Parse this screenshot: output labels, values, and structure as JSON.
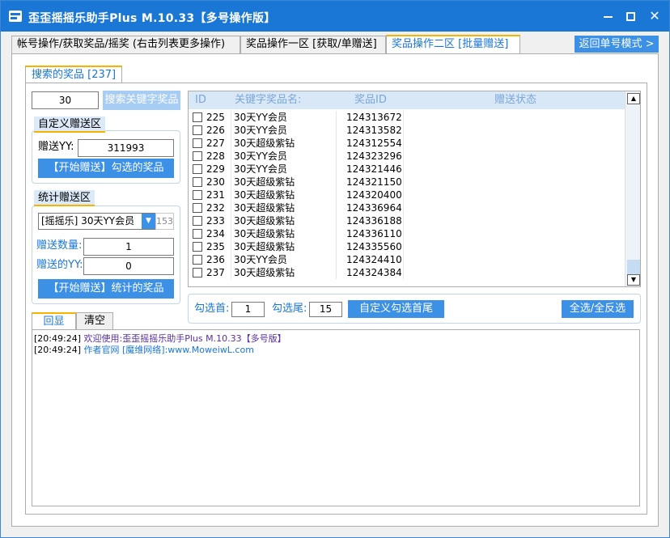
{
  "window": {
    "title": "歪歪摇摇乐助手Plus M.10.33【多号操作版】"
  },
  "tabs": [
    {
      "label": "帐号操作/获取奖品/摇奖 (右击列表更多操作)"
    },
    {
      "label": "奖品操作一区 [获取/单赠送]"
    },
    {
      "label": "奖品操作二区 [批量赠送]"
    }
  ],
  "return_button": "返回单号模式 >",
  "subtab": "搜索的奖品 [237]",
  "search": {
    "keyword": "30",
    "button": "搜索关键字奖品"
  },
  "custom_gift": {
    "title": "自定义赠送区",
    "yy_label": "赠送YY:",
    "yy_value": "311993",
    "button": "【开始赠送】勾选的奖品"
  },
  "stat_gift": {
    "title": "统计赠送区",
    "select_value": "[摇摇乐] 30天YY会员",
    "select_count": "153",
    "qty_label": "赠送数量:",
    "qty_value": "1",
    "yy_label": "赠送的YY:",
    "yy_value": "0",
    "button": "【开始赠送】统计的奖品"
  },
  "list": {
    "headers": [
      "ID",
      "关键字奖品名:",
      "奖品ID",
      "赠送状态"
    ],
    "rows": [
      {
        "id": "225",
        "name": "30天YY会员",
        "prize_id": "124313672",
        "status": ""
      },
      {
        "id": "226",
        "name": "30天YY会员",
        "prize_id": "124313582",
        "status": ""
      },
      {
        "id": "227",
        "name": "30天超级紫钻",
        "prize_id": "124312554",
        "status": ""
      },
      {
        "id": "228",
        "name": "30天YY会员",
        "prize_id": "124323296",
        "status": ""
      },
      {
        "id": "229",
        "name": "30天YY会员",
        "prize_id": "124321446",
        "status": ""
      },
      {
        "id": "230",
        "name": "30天超级紫钻",
        "prize_id": "124321150",
        "status": ""
      },
      {
        "id": "231",
        "name": "30天超级紫钻",
        "prize_id": "124320400",
        "status": ""
      },
      {
        "id": "232",
        "name": "30天超级紫钻",
        "prize_id": "124336964",
        "status": ""
      },
      {
        "id": "233",
        "name": "30天超级紫钻",
        "prize_id": "124336188",
        "status": ""
      },
      {
        "id": "234",
        "name": "30天超级紫钻",
        "prize_id": "124336110",
        "status": ""
      },
      {
        "id": "235",
        "name": "30天超级紫钻",
        "prize_id": "124335560",
        "status": ""
      },
      {
        "id": "236",
        "name": "30天YY会员",
        "prize_id": "124324410",
        "status": ""
      },
      {
        "id": "237",
        "name": "30天超级紫钻",
        "prize_id": "124324384",
        "status": ""
      }
    ]
  },
  "select_range": {
    "first_label": "勾选首:",
    "first_value": "1",
    "last_label": "勾选尾:",
    "last_value": "15",
    "custom_button": "自定义勾选首尾",
    "all_button": "全选/全反选"
  },
  "log_tabs": [
    "回显",
    "清空"
  ],
  "log": [
    {
      "time": "[20:49:24]",
      "prefix": "欢迎使用:",
      "text": "歪歪摇摇乐助手Plus M.10.33【多号版】"
    },
    {
      "time": "[20:49:24]",
      "prefix": "作者官网 [魔维网络]:",
      "text": "www.MoweiwL.com"
    }
  ],
  "colors": {
    "titlebar": "#1a77d6",
    "button": "#3c90e6",
    "tab_accent": "#f4b400",
    "log_purple": "#5a2ea6",
    "log_blue": "#1a77d6"
  }
}
